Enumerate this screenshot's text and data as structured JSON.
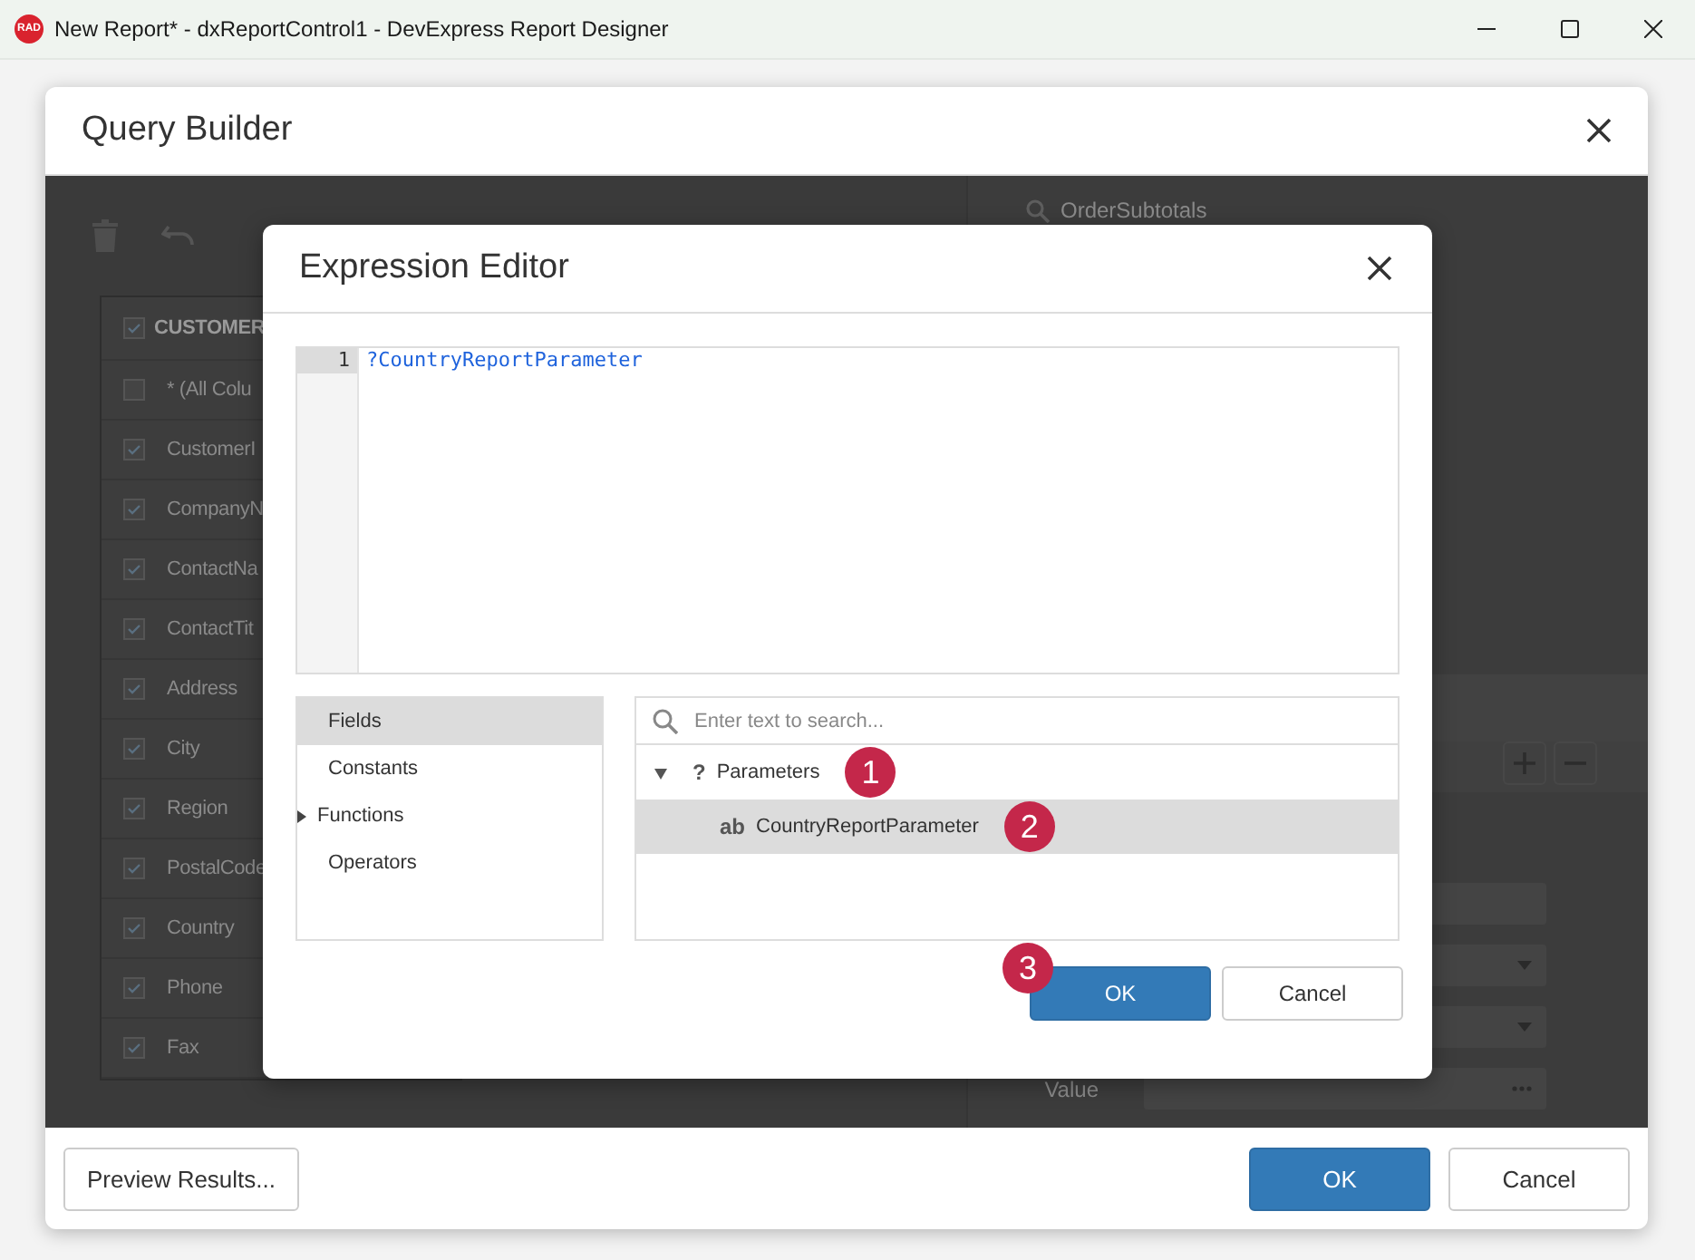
{
  "window": {
    "logo_text": "RAD",
    "title": "New Report* - dxReportControl1 - DevExpress Report Designer"
  },
  "query_builder": {
    "title": "Query Builder",
    "table": {
      "name": "CUSTOMER",
      "checked": true,
      "columns": [
        {
          "name": "* (All Colu",
          "checked": false
        },
        {
          "name": "CustomerI",
          "checked": true
        },
        {
          "name": "CompanyN",
          "checked": true
        },
        {
          "name": "ContactNa",
          "checked": true
        },
        {
          "name": "ContactTit",
          "checked": true
        },
        {
          "name": "Address",
          "checked": true
        },
        {
          "name": "City",
          "checked": true
        },
        {
          "name": "Region",
          "checked": true
        },
        {
          "name": "PostalCode",
          "checked": true
        },
        {
          "name": "Country",
          "checked": true
        },
        {
          "name": "Phone",
          "checked": true
        },
        {
          "name": "Fax",
          "checked": true
        }
      ]
    },
    "search_field": {
      "value": "OrderSubtotals"
    },
    "parameter_label": "Value",
    "buttons": [
      {
        "label": "Preview Results...",
        "kind": "default"
      },
      {
        "label": "OK",
        "kind": "primary"
      },
      {
        "label": "Cancel",
        "kind": "default"
      }
    ]
  },
  "expression_editor": {
    "title": "Expression Editor",
    "code_lines": [
      {
        "number": "1",
        "text": "?CountryReportParameter"
      }
    ],
    "categories": [
      {
        "label": "Fields",
        "selected": true,
        "expandable": false
      },
      {
        "label": "Constants",
        "selected": false,
        "expandable": false
      },
      {
        "label": "Functions",
        "selected": false,
        "expandable": true
      },
      {
        "label": "Operators",
        "selected": false,
        "expandable": false
      }
    ],
    "search": {
      "placeholder": "Enter text to search..."
    },
    "tree": [
      {
        "icon_text": "?",
        "label": "Parameters",
        "expanded": true,
        "selected": false,
        "callout": "1",
        "children": [
          {
            "icon_text": "ab",
            "label": "CountryReportParameter",
            "selected": true,
            "callout": "2"
          }
        ]
      }
    ],
    "buttons": [
      {
        "label": "OK",
        "kind": "primary",
        "callout": "3"
      },
      {
        "label": "Cancel",
        "kind": "default"
      }
    ]
  }
}
